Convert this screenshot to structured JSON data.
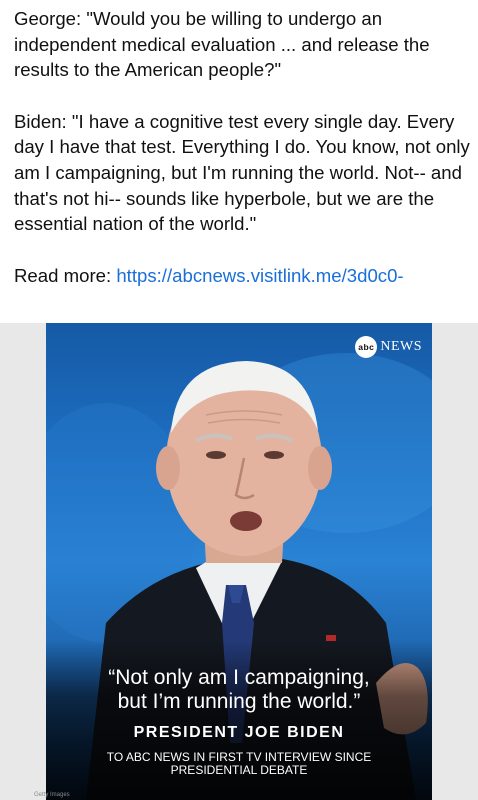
{
  "post": {
    "question": "George: \"Would you be willing to undergo an independent medical evaluation ... and release the results to the American people?\"",
    "answer": "Biden: \"I have a cognitive test every single day. Every day I have that test. Everything I do. You know, not only am I campaigning, but I'm running the world. Not-- and that's not hi-- sounds like hyperbole, but we are the essential nation of the world.\"",
    "read_more_label": "Read more:",
    "read_more_link": "https://abcnews.visitlink.me/3d0c0-"
  },
  "image": {
    "logo_badge": "abc",
    "logo_text": "NEWS",
    "quote_line1": "“Not only am I campaigning,",
    "quote_line2": "but I’m running the world.”",
    "speaker": "PRESIDENT JOE BIDEN",
    "context_line1": "TO ABC NEWS IN FIRST TV INTERVIEW SINCE",
    "context_line2": "PRESIDENTIAL DEBATE",
    "credit": "Getty Images"
  },
  "colors": {
    "link": "#1a6fd8",
    "background_blue": "#1e6fc2",
    "text": "#111111"
  }
}
